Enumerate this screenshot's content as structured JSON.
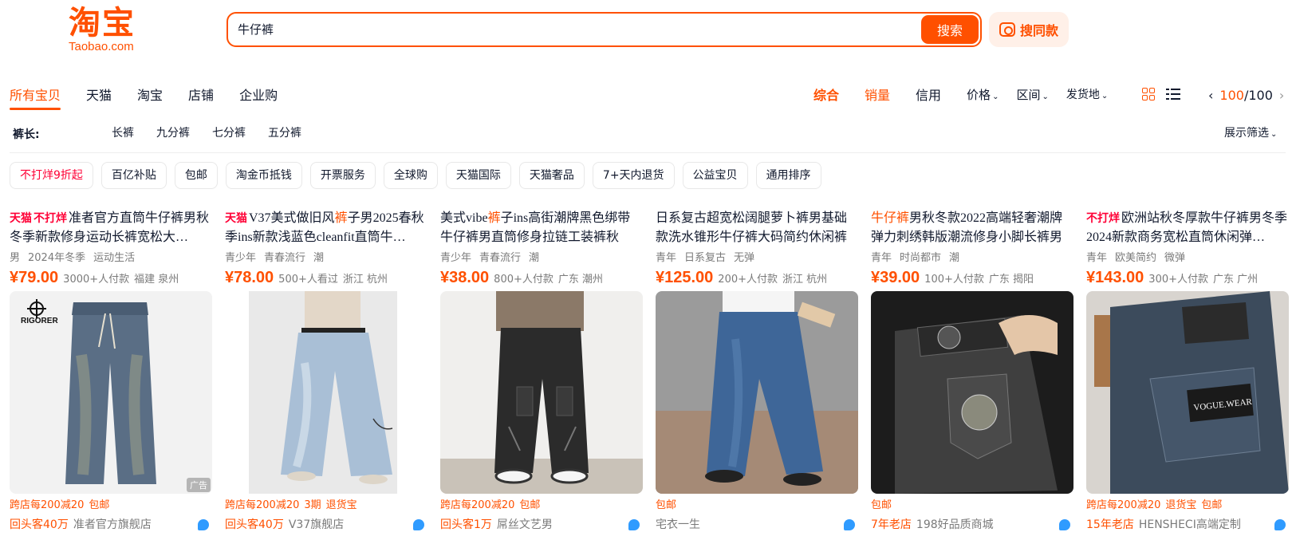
{
  "header": {
    "logo_mark": "淘宝",
    "logo_sub": "Taobao.com",
    "search_value": "牛仔裤",
    "search_button": "搜索",
    "same_style_button": "搜同款"
  },
  "tabs": [
    "所有宝贝",
    "天猫",
    "淘宝",
    "店铺",
    "企业购"
  ],
  "sorts": {
    "comprehensive": "综合",
    "sales": "销量",
    "credit": "信用",
    "price": "价格",
    "range": "区间",
    "ship_from": "发货地"
  },
  "pager": {
    "prev": "‹",
    "current": "100",
    "total": "/100",
    "next": "›"
  },
  "filter": {
    "label": "裤长:",
    "options": [
      "长裤",
      "九分裤",
      "七分裤",
      "五分裤"
    ],
    "toggle": "展示筛选"
  },
  "chips": [
    "不打烊9折起",
    "百亿补贴",
    "包邮",
    "淘金币抵钱",
    "开票服务",
    "全球购",
    "天猫国际",
    "天猫奢品",
    "7+天内退货",
    "公益宝贝",
    "通用排序"
  ],
  "colors": {
    "accent": "#ff5000",
    "tag_red": "#ff0036",
    "muted": "#7a7a7a"
  },
  "products": [
    {
      "tag1": "天猫",
      "tag2": "不打烊",
      "t1": "准者官方直筒",
      "t2": "牛仔裤",
      "t3": "男秋冬季新款修身运动长裤宽松大…",
      "attrs": [
        "男",
        "2024年冬季",
        "运动生活"
      ],
      "price": "¥79.00",
      "sold": "3000+人付款",
      "loc": "福建 泉州",
      "ad": "广告",
      "promos": [
        "跨店每200减20",
        "包邮"
      ],
      "repeat": "回头客40万",
      "shop": "准者官方旗舰店"
    },
    {
      "tag1": "天猫",
      "tag2": "",
      "t1": "V37美式做旧风",
      "t2": "裤",
      "t3": "子男2025春秋季ins新款浅蓝色cleanfit直筒牛…",
      "attrs": [
        "青少年",
        "青春流行",
        "潮"
      ],
      "price": "¥78.00",
      "sold": "500+人看过",
      "loc": "浙江 杭州",
      "ad": "",
      "promos": [
        "跨店每200减20",
        "3期",
        "退货宝"
      ],
      "repeat": "回头客40万",
      "shop": "V37旗舰店"
    },
    {
      "tag1": "",
      "tag2": "",
      "t1": "美式vibe",
      "t2": "裤",
      "t3": "子ins高街潮牌黑色绑带牛仔裤男直筒修身拉链工装裤秋",
      "attrs": [
        "青少年",
        "青春流行",
        "潮"
      ],
      "price": "¥38.00",
      "sold": "800+人付款",
      "loc": "广东 潮州",
      "ad": "",
      "promos": [
        "跨店每200减20",
        "包邮"
      ],
      "repeat": "回头客1万",
      "shop": "屌丝文艺男"
    },
    {
      "tag1": "",
      "tag2": "",
      "t1": "日系复古超宽松阔腿萝卜裤男基础款洗水锥形",
      "t2": "牛仔裤",
      "t3": "大码简约休闲裤",
      "attrs": [
        "青年",
        "日系复古",
        "无弹"
      ],
      "price": "¥125.00",
      "sold": "200+人付款",
      "loc": "浙江 杭州",
      "ad": "",
      "promos": [
        "包邮"
      ],
      "repeat": "",
      "shop": "宅衣一生"
    },
    {
      "tag1": "",
      "tag2": "",
      "t1": "",
      "t2": "牛仔裤",
      "t3": "男秋冬款2022高端轻奢潮牌弹力刺绣韩版潮流修身小脚长裤男",
      "attrs": [
        "青年",
        "时尚都市",
        "潮"
      ],
      "price": "¥39.00",
      "sold": "100+人付款",
      "loc": "广东 揭阳",
      "ad": "",
      "promos": [
        "包邮"
      ],
      "repeat": "7年老店",
      "shop": "198好品质商城"
    },
    {
      "tag1": "",
      "tag2": "不打烊",
      "t1": "欧洲站秋冬厚款",
      "t2": "牛仔裤",
      "t3": "男冬季2024新款商务宽松直筒休闲弹…",
      "attrs": [
        "青年",
        "欧美简约",
        "微弹"
      ],
      "price": "¥143.00",
      "sold": "300+人付款",
      "loc": "广东 广州",
      "ad": "",
      "promos": [
        "跨店每200减20",
        "退货宝",
        "包邮"
      ],
      "repeat": "15年老店",
      "shop": "HENSHECI高端定制"
    }
  ]
}
